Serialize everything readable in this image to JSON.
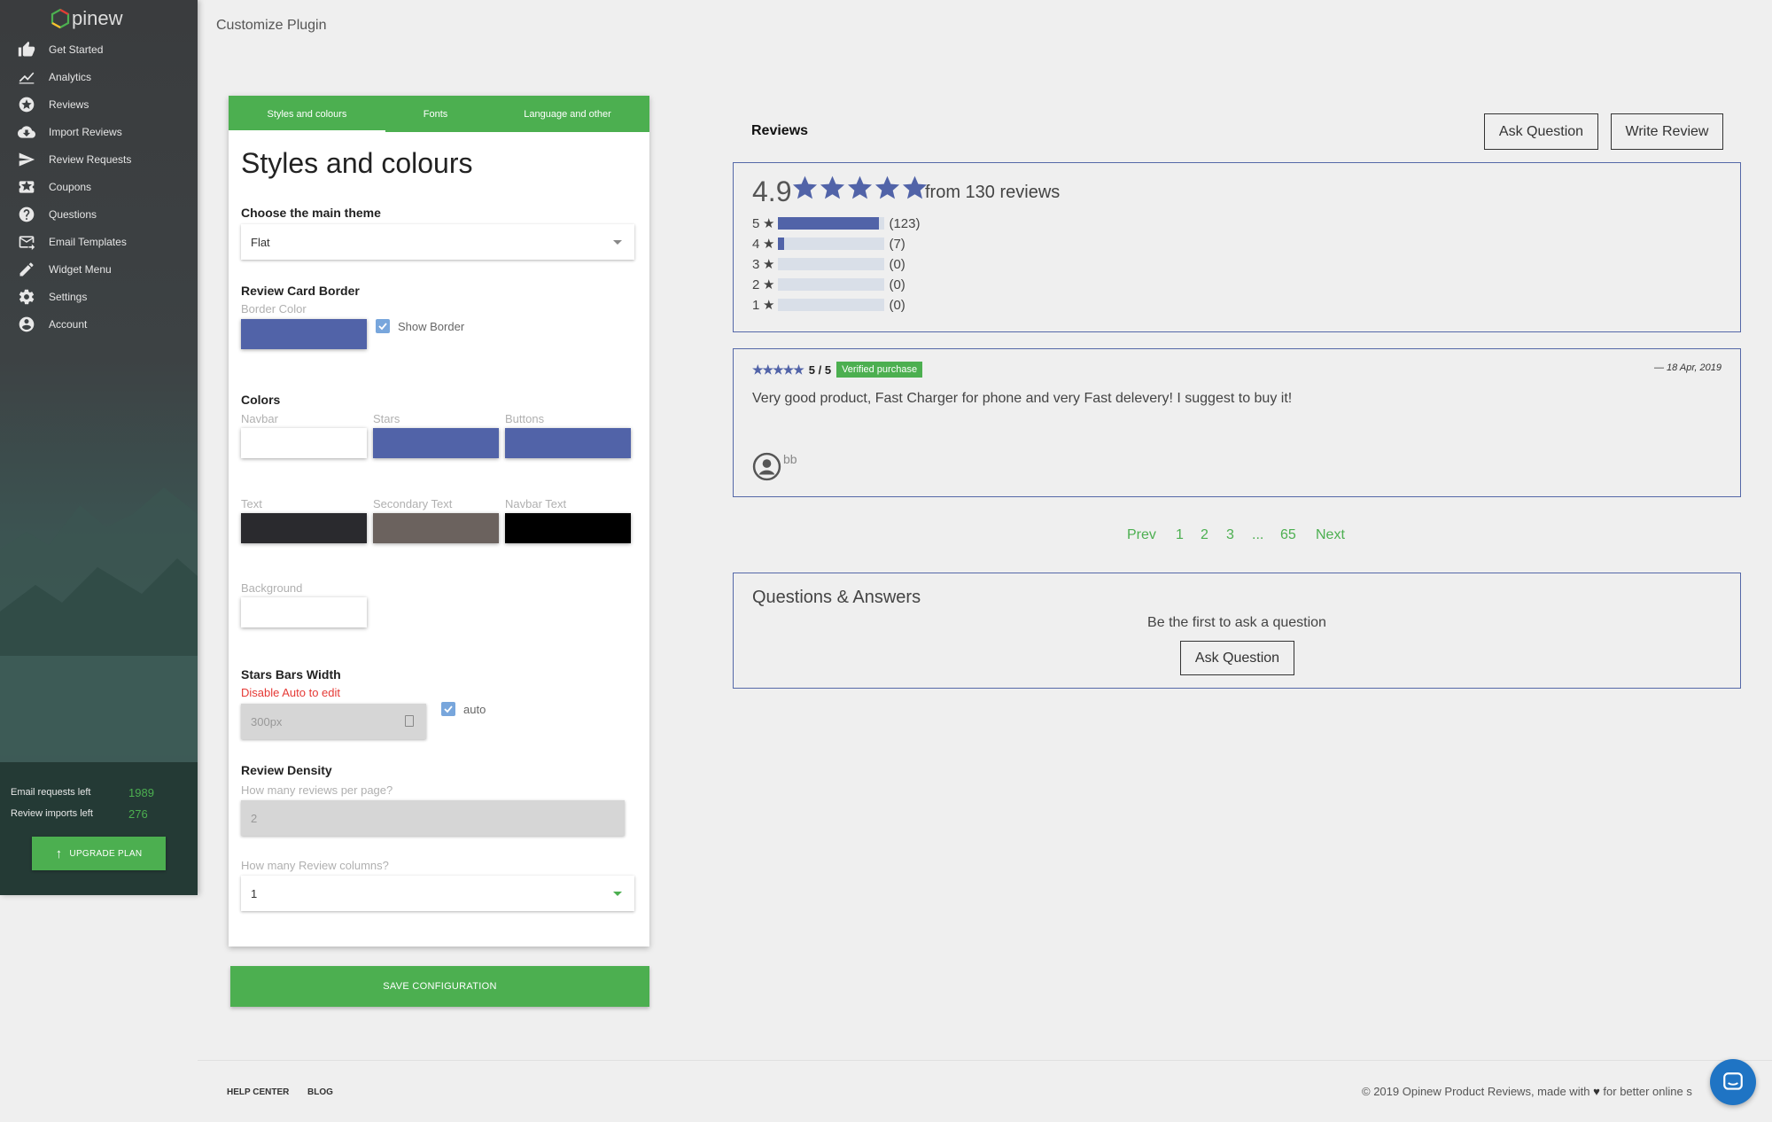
{
  "app": {
    "logo_text": "pinew"
  },
  "page_title": "Customize Plugin",
  "sidebar": {
    "items": [
      {
        "label": "Get Started",
        "icon": "thumbs-up-icon"
      },
      {
        "label": "Analytics",
        "icon": "line-chart-icon"
      },
      {
        "label": "Reviews",
        "icon": "star-circle-icon"
      },
      {
        "label": "Import Reviews",
        "icon": "cloud-download-icon"
      },
      {
        "label": "Review Requests",
        "icon": "send-icon"
      },
      {
        "label": "Coupons",
        "icon": "ticket-icon"
      },
      {
        "label": "Questions",
        "icon": "help-circle-icon"
      },
      {
        "label": "Email Templates",
        "icon": "email-icon"
      },
      {
        "label": "Widget Menu",
        "icon": "pencil-icon"
      },
      {
        "label": "Settings",
        "icon": "gear-icon"
      },
      {
        "label": "Account",
        "icon": "account-circle-icon"
      }
    ],
    "email_requests_label": "Email requests left",
    "email_requests_value": "1989",
    "review_imports_label": "Review imports left",
    "review_imports_value": "276",
    "upgrade_label": "UPGRADE PLAN"
  },
  "panel": {
    "tabs": [
      "Styles and colours",
      "Fonts",
      "Language and other"
    ],
    "heading": "Styles and colours",
    "theme_label": "Choose the main theme",
    "theme_value": "Flat",
    "border_section": "Review Card Border",
    "border_color_label": "Border Color",
    "show_border_label": "Show Border",
    "colors_section": "Colors",
    "colors": {
      "navbar": {
        "label": "Navbar",
        "value": "#ffffff"
      },
      "stars": {
        "label": "Stars",
        "value": "#5163a8"
      },
      "buttons": {
        "label": "Buttons",
        "value": "#5163a8"
      },
      "text": {
        "label": "Text",
        "value": "#2a2a2e"
      },
      "secondary_text": {
        "label": "Secondary Text",
        "value": "#6b625e"
      },
      "navbar_text": {
        "label": "Navbar Text",
        "value": "#000000"
      },
      "background": {
        "label": "Background",
        "value": "#ffffff"
      }
    },
    "border_color_value": "#5163a8",
    "stars_width_section": "Stars Bars Width",
    "stars_width_hint": "Disable Auto to edit",
    "stars_width_value": "300px",
    "auto_label": "auto",
    "density_section": "Review Density",
    "per_page_label": "How many reviews per page?",
    "per_page_value": "2",
    "columns_label": "How many Review columns?",
    "columns_value": "1",
    "save_label": "SAVE CONFIGURATION"
  },
  "preview": {
    "title": "Reviews",
    "ask_question": "Ask Question",
    "write_review": "Write Review",
    "score": "4.9",
    "from_text": "from 130 reviews",
    "distribution": [
      {
        "stars": "5",
        "count": "(123)",
        "fraction": 0.946
      },
      {
        "stars": "4",
        "count": "(7)",
        "fraction": 0.054
      },
      {
        "stars": "3",
        "count": "(0)",
        "fraction": 0
      },
      {
        "stars": "2",
        "count": "(0)",
        "fraction": 0
      },
      {
        "stars": "1",
        "count": "(0)",
        "fraction": 0
      }
    ],
    "review": {
      "rating": "5 / 5",
      "badge": "Verified purchase",
      "date": "— 18 Apr, 2019",
      "body": "Very good product, Fast Charger for phone and very Fast delevery! I suggest to buy it!",
      "author": "bb"
    },
    "pagination": [
      "Prev",
      "1",
      "2",
      "3",
      "...",
      "65",
      "Next"
    ],
    "qa_title": "Questions & Answers",
    "qa_empty": "Be the first to ask a question",
    "qa_button": "Ask Question"
  },
  "footer": {
    "help_center": "HELP CENTER",
    "blog": "BLOG",
    "copyright_prefix": "© 2019 Opinew Product Reviews, made with",
    "copyright_suffix": "for better online s"
  },
  "colors": {
    "accent": "#4caf50",
    "brand_blue": "#5163a8",
    "chat_blue": "#1f74c4"
  }
}
